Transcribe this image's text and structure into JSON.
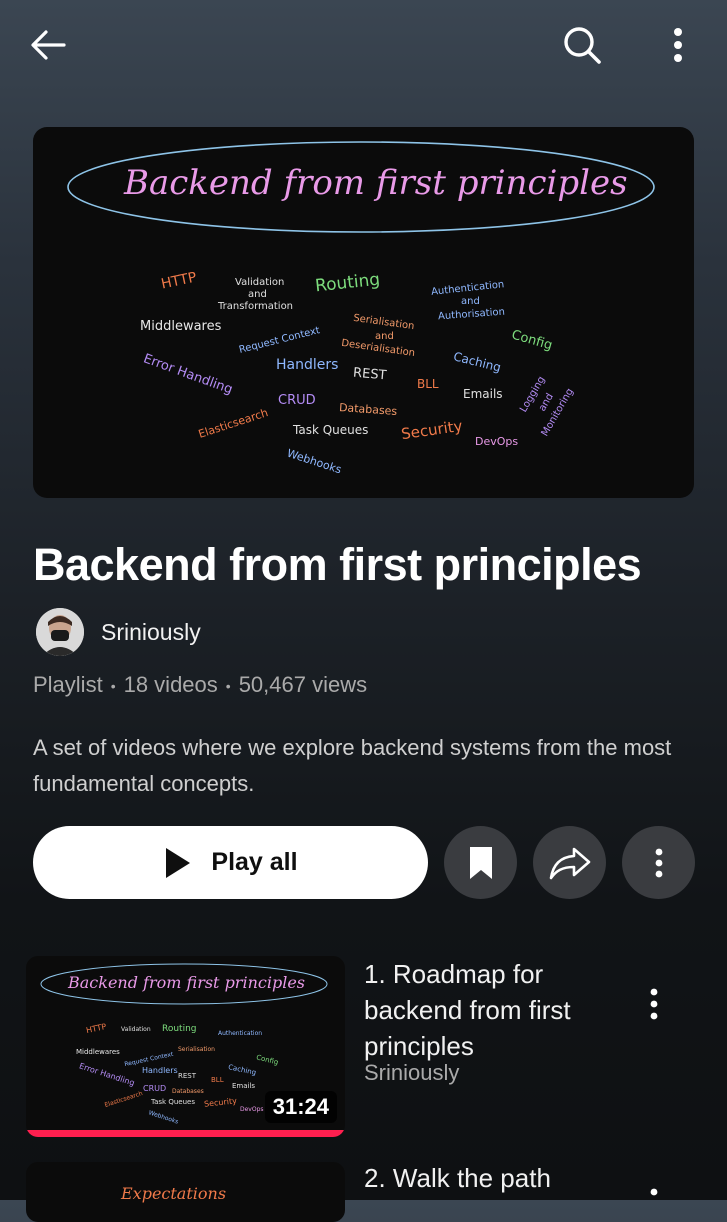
{
  "header": {
    "back_icon": "arrow-left-icon",
    "search_icon": "search-icon",
    "more_icon": "more-vertical-icon"
  },
  "hero": {
    "heading": "Backend from first principles",
    "words": [
      "HTTP",
      "Validation",
      "and",
      "Transformation",
      "Routing",
      "Authentication",
      "and",
      "Authorisation",
      "Middlewares",
      "Request Context",
      "Serialisation",
      "and",
      "Deserialisation",
      "Config",
      "Handlers",
      "Caching",
      "Error Handling",
      "REST",
      "BLL",
      "Emails",
      "Logging",
      "and",
      "Monitoring",
      "CRUD",
      "Databases",
      "Elasticsearch",
      "Task Queues",
      "Security",
      "DevOps",
      "Webhooks"
    ]
  },
  "playlist": {
    "title": "Backend from first principles",
    "channel": "Sriniously",
    "type": "Playlist",
    "video_count": "18 videos",
    "views": "50,467 views",
    "description": "A set of videos where we explore backend systems from the most fundamental concepts."
  },
  "actions": {
    "play_all_label": "Play all",
    "save_icon": "bookmark-icon",
    "share_icon": "share-icon",
    "more_icon": "more-vertical-icon"
  },
  "videos": [
    {
      "title": "1. Roadmap for backend from first principles",
      "channel": "Sriniously",
      "duration": "31:24",
      "watched_fraction": 1.0,
      "thumb_heading": "Backend from first principles",
      "thumb_words": [
        "HTTP",
        "Validation",
        "Routing",
        "Authentication",
        "Middlewares",
        "Request Context",
        "Serialisation",
        "Config",
        "Handlers",
        "Caching",
        "Error Handling",
        "REST",
        "BLL",
        "Emails",
        "CRUD",
        "Databases",
        "Elasticsearch",
        "Task Queues",
        "Security",
        "DevOps",
        "Webhooks"
      ]
    },
    {
      "title": "2. Walk the path",
      "thumb_heading": "Expectations"
    }
  ],
  "colors": {
    "accent_progress": "#ff1f4f",
    "play_button_bg": "#ffffff",
    "round_button_bg": "#3a3c40"
  }
}
